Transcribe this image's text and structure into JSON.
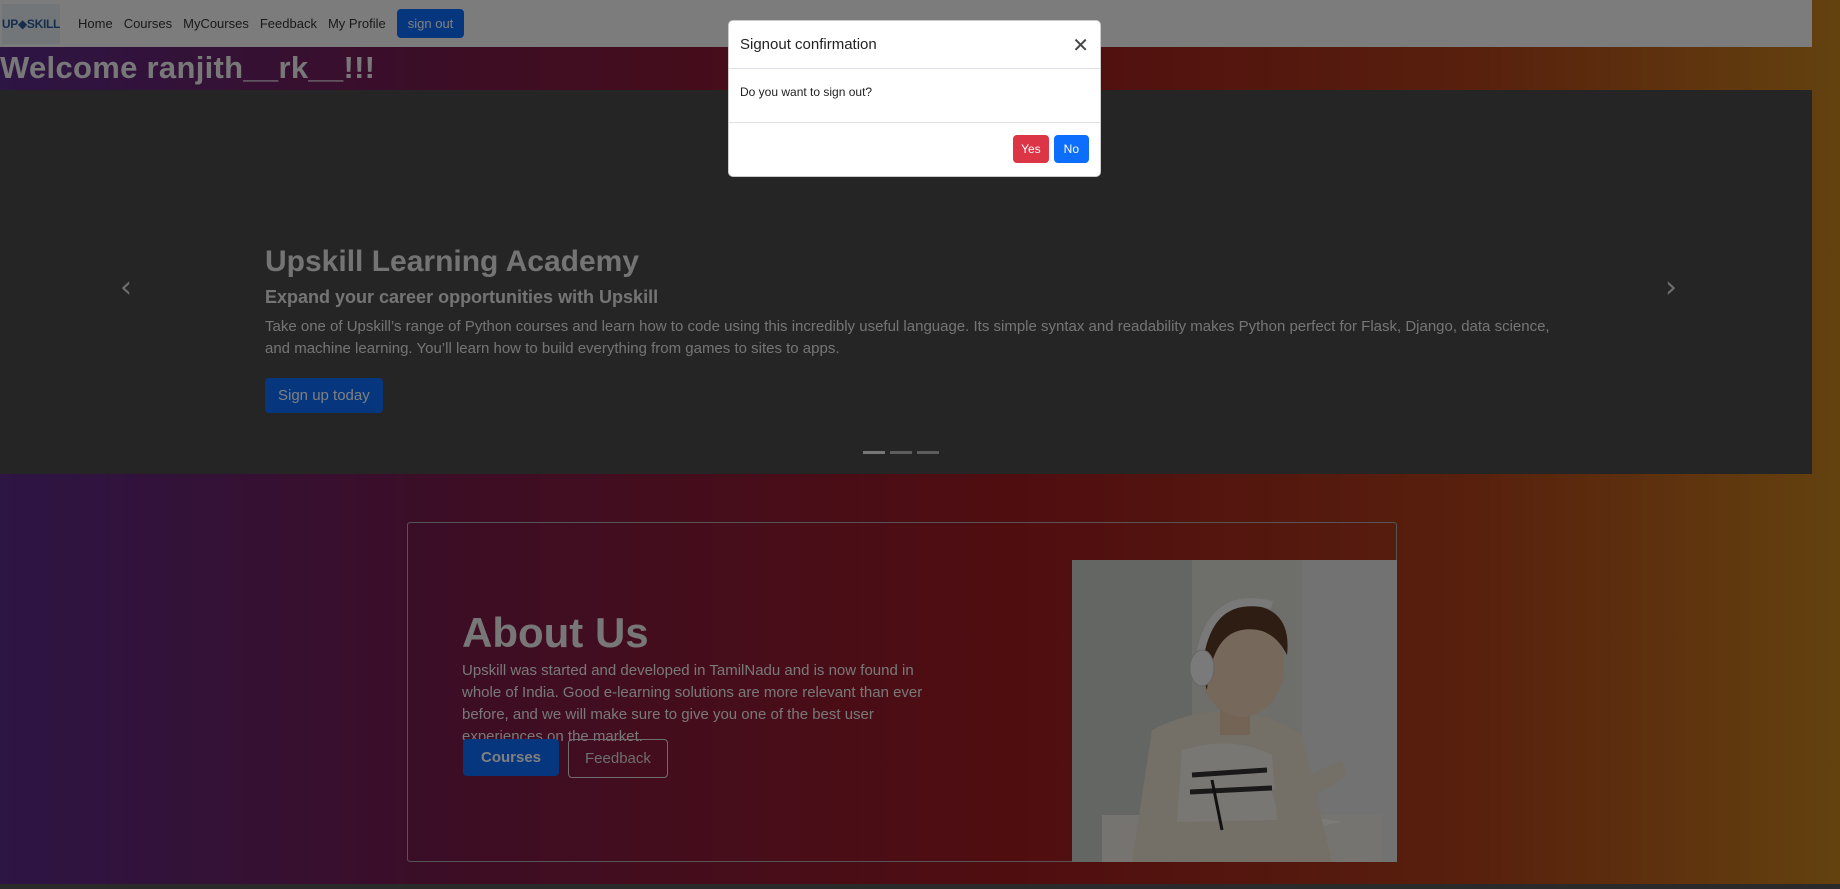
{
  "nav": {
    "logo_text": "UP◆SKILL",
    "links": [
      "Home",
      "Courses",
      "MyCourses",
      "Feedback",
      "My Profile"
    ],
    "signout_label": "sign out"
  },
  "welcome": "Welcome ranjith__rk__!!!",
  "carousel": {
    "title": "Upskill Learning Academy",
    "subtitle": "Expand your career opportunities with Upskill",
    "text": "Take one of Upskill’s range of Python courses and learn how to code using this incredibly useful language. Its simple syntax and readability makes Python perfect for Flask, Django, data science, and machine learning. You’ll learn how to build everything from games to sites to apps.",
    "cta_label": "Sign up today",
    "prev_icon": "‹",
    "next_icon": "›",
    "slide_count": 3,
    "active_slide": 1
  },
  "about": {
    "title": "About Us",
    "text": "Upskill was started and developed in TamilNadu and is now found in whole of India. Good e-learning solutions are more relevant than ever before, and we will make sure to give you one of the best user experiences on the market.",
    "courses_label": "Courses",
    "feedback_label": "Feedback"
  },
  "modal": {
    "title": "Signout confirmation",
    "close_icon": "✕",
    "body": "Do you want to sign out?",
    "yes_label": "Yes",
    "no_label": "No"
  },
  "colors": {
    "primary": "#0d6efd",
    "danger": "#dc3545"
  }
}
